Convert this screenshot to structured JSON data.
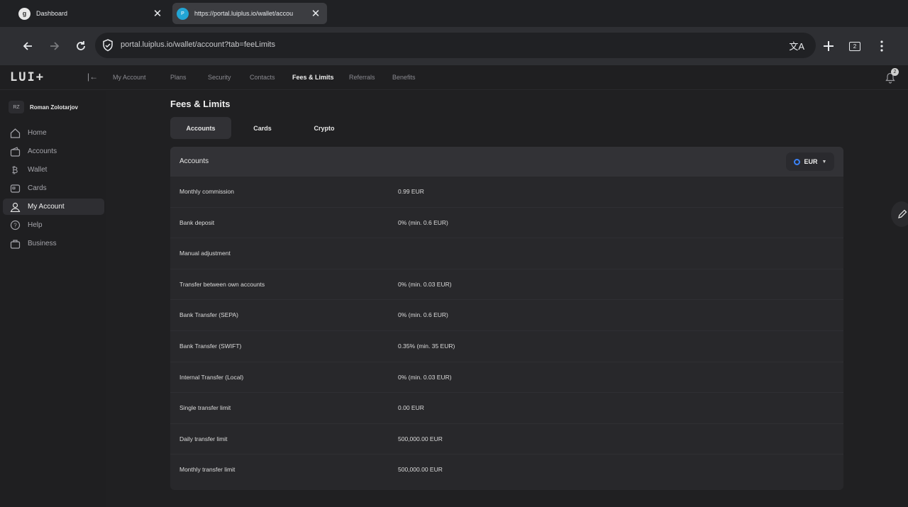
{
  "browser": {
    "tabs": [
      {
        "title": "Dashboard",
        "favicon": "g"
      },
      {
        "title": "https://portal.luiplus.io/wallet/accou",
        "favicon": "P"
      }
    ],
    "url": "portal.luiplus.io/wallet/account?tab=feeLimits",
    "extensions_count": "2"
  },
  "app": {
    "logo": "LUI+",
    "topnav": [
      "My Account",
      "Plans",
      "Security",
      "Contacts",
      "Fees & Limits",
      "Referrals",
      "Benefits"
    ],
    "active_nav": "Fees & Limits",
    "notifications": "2",
    "user": {
      "initials": "RZ",
      "name": "Roman Zolotarjov"
    },
    "sidebar": [
      {
        "label": "Home",
        "icon": "home-icon"
      },
      {
        "label": "Accounts",
        "icon": "wallet-icon"
      },
      {
        "label": "Wallet",
        "icon": "bitcoin-icon"
      },
      {
        "label": "Cards",
        "icon": "card-icon"
      },
      {
        "label": "My Account",
        "icon": "user-icon"
      },
      {
        "label": "Help",
        "icon": "help-icon"
      },
      {
        "label": "Business",
        "icon": "briefcase-icon"
      }
    ],
    "page_title": "Fees & Limits",
    "subtabs": [
      "Accounts",
      "Cards",
      "Crypto"
    ],
    "card": {
      "title": "Accounts",
      "currency": "EUR",
      "rows": [
        {
          "label": "Monthly commission",
          "value": "0.99 EUR"
        },
        {
          "label": "Bank deposit",
          "value": "0% (min. 0.6 EUR)"
        },
        {
          "label": "Manual adjustment",
          "value": ""
        },
        {
          "label": "Transfer between own accounts",
          "value": "0% (min. 0.03 EUR)"
        },
        {
          "label": "Bank Transfer (SEPA)",
          "value": "0% (min. 0.6 EUR)"
        },
        {
          "label": "Bank Transfer (SWIFT)",
          "value": "0.35% (min. 35 EUR)"
        },
        {
          "label": "Internal Transfer (Local)",
          "value": "0% (min. 0.03 EUR)"
        },
        {
          "label": "Single transfer limit",
          "value": "0.00 EUR"
        },
        {
          "label": "Daily transfer limit",
          "value": "500,000.00 EUR"
        },
        {
          "label": "Monthly transfer limit",
          "value": "500,000.00 EUR"
        }
      ]
    }
  },
  "colors": {
    "accent": "#3b82f6",
    "background": "#1e1e20",
    "card": "#28282b"
  }
}
